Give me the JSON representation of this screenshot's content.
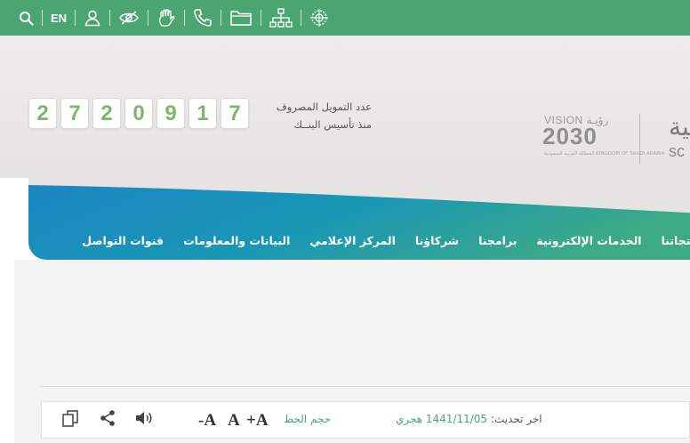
{
  "topbar": {
    "language": "EN",
    "icons": [
      "search-icon",
      "user-icon",
      "eye-slash-icon",
      "sign-language-icon",
      "phone-icon",
      "folder-icon",
      "sitemap-icon",
      "emblem-icon"
    ]
  },
  "counter": {
    "digits": [
      "2",
      "7",
      "2",
      "0",
      "9",
      "1",
      "7"
    ],
    "label_line1": "عدد التمويل المصروف",
    "label_line2": "منذ تأسيس البنــك"
  },
  "vision": {
    "top_text": "VISION رؤيـة",
    "year": "2030",
    "sub_text": "المملكة العربية السعودية KINGDOM OF SAUDI ARABIA"
  },
  "brand": {
    "arabic": "بية",
    "english": "sc"
  },
  "nav": {
    "items": [
      {
        "label": "ا"
      },
      {
        "label": "منتجاتنا"
      },
      {
        "label": "الخدمات الإلكترونية"
      },
      {
        "label": "برامجنا"
      },
      {
        "label": "شركاؤنا"
      },
      {
        "label": "المركز الإعلامي"
      },
      {
        "label": "البيانات والمعلومات"
      },
      {
        "label": "قنوات التواصل"
      }
    ]
  },
  "tools": {
    "font_minus": "-A",
    "font_normal": "A",
    "font_plus": "+A",
    "font_label": "حجم الخط",
    "update_prefix": "اخر تحديث:",
    "update_date": "1441/11/05 هجري"
  },
  "colors": {
    "green": "#4aa570",
    "digit_green": "#7cb86a",
    "blue": "#1d8fc1"
  }
}
